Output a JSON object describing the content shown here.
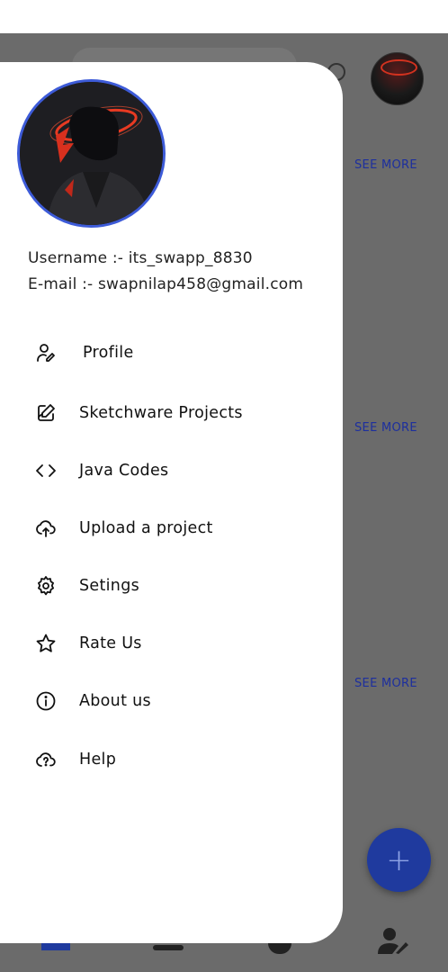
{
  "user": {
    "username_line": "Username :- its_swapp_8830",
    "email_line": "E-mail :- swapnilap458@gmail.com"
  },
  "menu": {
    "items": [
      {
        "label": "Profile",
        "icon": "user-edit-icon"
      },
      {
        "label": "Sketchware Projects",
        "icon": "edit-square-icon"
      },
      {
        "label": "Java Codes",
        "icon": "code-icon"
      },
      {
        "label": "Upload a project",
        "icon": "cloud-upload-icon"
      },
      {
        "label": "Setings",
        "icon": "gear-icon"
      },
      {
        "label": "Rate Us",
        "icon": "star-icon"
      },
      {
        "label": "About us",
        "icon": "info-icon"
      },
      {
        "label": "Help",
        "icon": "cloud-help-icon"
      }
    ]
  },
  "background": {
    "see_more_label": "SEE MORE",
    "fab_label": "+"
  },
  "colors": {
    "accent": "#1f3a9e",
    "avatar_ring": "#3d5bd8",
    "scrim": "#6b6b6b",
    "drawer_bg": "#ffffff"
  }
}
